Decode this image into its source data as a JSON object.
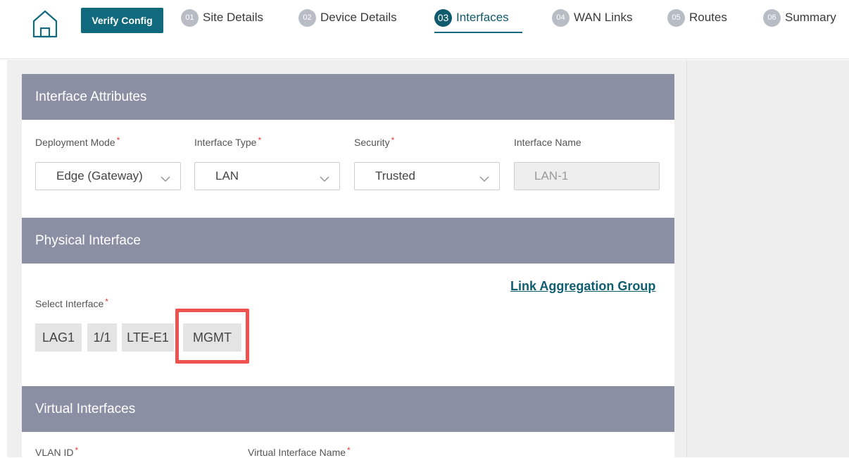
{
  "header": {
    "verify_label": "Verify Config",
    "steps": [
      {
        "num": "01",
        "label": "Site Details"
      },
      {
        "num": "02",
        "label": "Device Details"
      },
      {
        "num": "03",
        "label": "Interfaces",
        "active": true
      },
      {
        "num": "04",
        "label": "WAN Links"
      },
      {
        "num": "05",
        "label": "Routes"
      },
      {
        "num": "06",
        "label": "Summary"
      }
    ]
  },
  "interface_attributes": {
    "title": "Interface Attributes",
    "deployment_mode": {
      "label": "Deployment Mode",
      "value": "Edge (Gateway)"
    },
    "interface_type": {
      "label": "Interface Type",
      "value": "LAN"
    },
    "security": {
      "label": "Security",
      "value": "Trusted"
    },
    "interface_name": {
      "label": "Interface Name",
      "value": "LAN-1"
    }
  },
  "physical_interface": {
    "title": "Physical Interface",
    "link_aggregation": "Link Aggregation Group",
    "select_label": "Select Interface",
    "options": [
      "LAG1",
      "1/1",
      "LTE-E1",
      "MGMT"
    ]
  },
  "virtual_interfaces": {
    "title": "Virtual Interfaces",
    "vlan_label": "VLAN ID",
    "vif_name_label": "Virtual Interface Name"
  },
  "colors": {
    "accent": "#10697c",
    "section_header": "#8b8fa3",
    "highlight": "#ef5350",
    "required": "#e33b3b"
  }
}
